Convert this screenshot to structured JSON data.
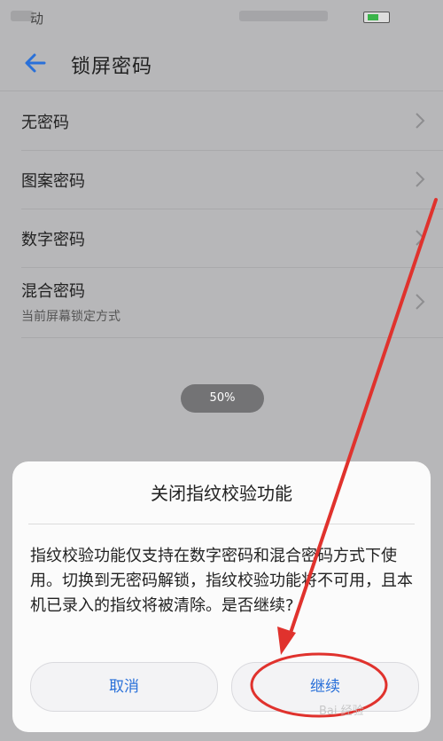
{
  "status_bar": {
    "carrier_text": "动"
  },
  "app_bar": {
    "title": "锁屏密码"
  },
  "options": [
    {
      "label": "无密码",
      "sub": ""
    },
    {
      "label": "图案密码",
      "sub": ""
    },
    {
      "label": "数字密码",
      "sub": ""
    },
    {
      "label": "混合密码",
      "sub": "当前屏幕锁定方式"
    }
  ],
  "toast": {
    "text": "50%"
  },
  "dialog": {
    "title": "关闭指纹校验功能",
    "message": "指纹校验功能仅支持在数字密码和混合密码方式下使用。切换到无密码解锁，指纹校验功能将不可用，且本机已录入的指纹将被清除。是否继续?",
    "cancel_label": "取消",
    "continue_label": "继续"
  },
  "watermark": "Bai 经验",
  "colors": {
    "accent": "#2970d9",
    "annotation": "#e0322d"
  },
  "icons": {
    "back": "arrow-left-icon",
    "chevron": "chevron-right-icon"
  }
}
